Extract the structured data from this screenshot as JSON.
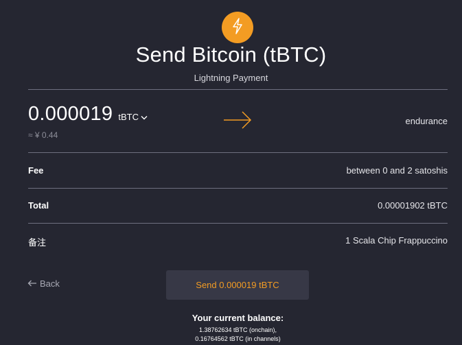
{
  "header": {
    "icon": "lightning-bolt-icon",
    "title": "Send Bitcoin (tBTC)",
    "subtitle": "Lightning Payment"
  },
  "payment": {
    "amount": "0.000019",
    "unit": "tBTC",
    "fiat_estimate": "≈ ¥ 0.44",
    "destination": "endurance"
  },
  "details": {
    "fee_label": "Fee",
    "fee_value": "between 0 and 2 satoshis",
    "total_label": "Total",
    "total_value": "0.00001902 tBTC",
    "memo_label": "备注",
    "memo_value": "1 Scala Chip Frappuccino"
  },
  "actions": {
    "back_label": "Back",
    "send_label": "Send 0.000019 tBTC"
  },
  "balance": {
    "title": "Your current balance:",
    "onchain": "1.38762634 tBTC (onchain),",
    "channels": "0.16764562 tBTC (in channels)"
  },
  "colors": {
    "background": "#252631",
    "accent": "#f39c23",
    "divider": "#6f7080",
    "button": "#373846"
  }
}
